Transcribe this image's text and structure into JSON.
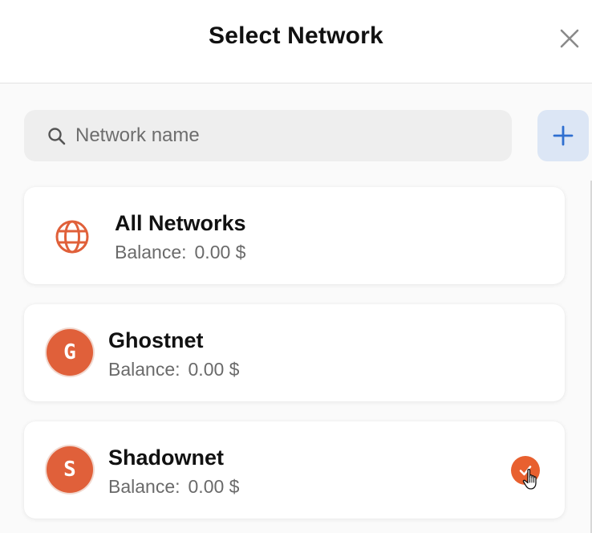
{
  "header": {
    "title": "Select Network",
    "close_icon": "close-icon"
  },
  "search": {
    "placeholder": "Network name",
    "value": "",
    "icon": "search-icon"
  },
  "add_button": {
    "icon": "plus-icon"
  },
  "networks": [
    {
      "name": "All Networks",
      "balance_label": "Balance:",
      "balance_value": "0.00 $",
      "icon": "globe-icon",
      "selected": false
    },
    {
      "name": "Ghostnet",
      "balance_label": "Balance:",
      "balance_value": "0.00 $",
      "avatar_letter": "G",
      "selected": false
    },
    {
      "name": "Shadownet",
      "balance_label": "Balance:",
      "balance_value": "0.00 $",
      "avatar_letter": "S",
      "selected": true
    }
  ],
  "colors": {
    "accent_orange": "#e0603a",
    "add_button_bg": "#dce6f5",
    "add_button_icon": "#2f6fd0",
    "search_bg": "#eeeeee"
  }
}
